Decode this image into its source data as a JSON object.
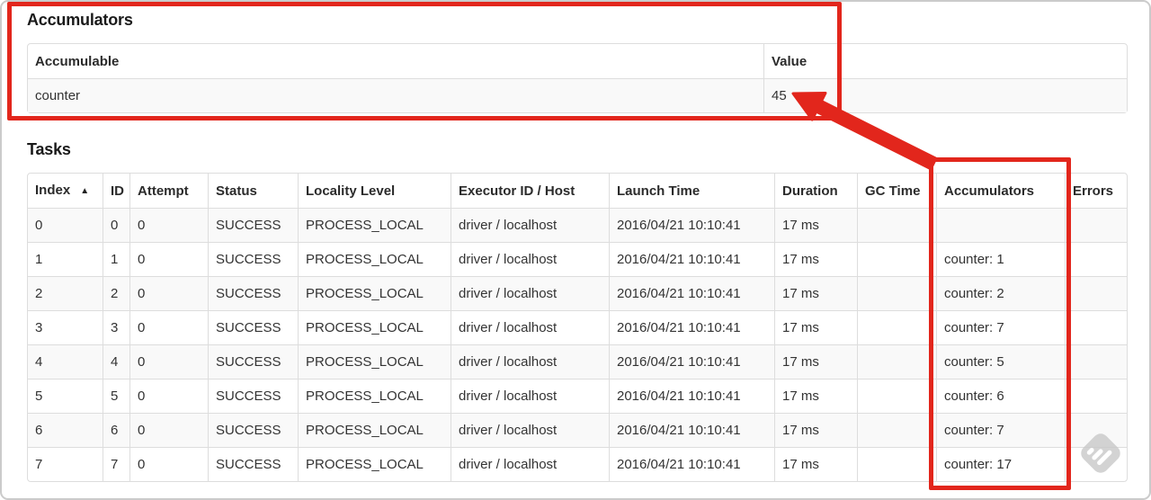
{
  "theme": {
    "annotation_color": "#e2261c",
    "table_border_color": "#dddddd",
    "stripe_color": "#f9f9f9",
    "text_color": "#333333",
    "watermark_color": "#c9c9c9"
  },
  "accumulators_section": {
    "title": "Accumulators",
    "table": {
      "headers": [
        "Accumulable",
        "Value"
      ],
      "rows": [
        [
          "counter",
          "45"
        ]
      ]
    }
  },
  "tasks_section": {
    "title": "Tasks",
    "table": {
      "headers": [
        "Index",
        "ID",
        "Attempt",
        "Status",
        "Locality Level",
        "Executor ID / Host",
        "Launch Time",
        "Duration",
        "GC Time",
        "Accumulators",
        "Errors"
      ],
      "sort_icon": "▲",
      "rows": [
        [
          "0",
          "0",
          "0",
          "SUCCESS",
          "PROCESS_LOCAL",
          "driver / localhost",
          "2016/04/21 10:10:41",
          "17 ms",
          "",
          "",
          ""
        ],
        [
          "1",
          "1",
          "0",
          "SUCCESS",
          "PROCESS_LOCAL",
          "driver / localhost",
          "2016/04/21 10:10:41",
          "17 ms",
          "",
          "counter: 1",
          ""
        ],
        [
          "2",
          "2",
          "0",
          "SUCCESS",
          "PROCESS_LOCAL",
          "driver / localhost",
          "2016/04/21 10:10:41",
          "17 ms",
          "",
          "counter: 2",
          ""
        ],
        [
          "3",
          "3",
          "0",
          "SUCCESS",
          "PROCESS_LOCAL",
          "driver / localhost",
          "2016/04/21 10:10:41",
          "17 ms",
          "",
          "counter: 7",
          ""
        ],
        [
          "4",
          "4",
          "0",
          "SUCCESS",
          "PROCESS_LOCAL",
          "driver / localhost",
          "2016/04/21 10:10:41",
          "17 ms",
          "",
          "counter: 5",
          ""
        ],
        [
          "5",
          "5",
          "0",
          "SUCCESS",
          "PROCESS_LOCAL",
          "driver / localhost",
          "2016/04/21 10:10:41",
          "17 ms",
          "",
          "counter: 6",
          ""
        ],
        [
          "6",
          "6",
          "0",
          "SUCCESS",
          "PROCESS_LOCAL",
          "driver / localhost",
          "2016/04/21 10:10:41",
          "17 ms",
          "",
          "counter: 7",
          ""
        ],
        [
          "7",
          "7",
          "0",
          "SUCCESS",
          "PROCESS_LOCAL",
          "driver / localhost",
          "2016/04/21 10:10:41",
          "17 ms",
          "",
          "counter: 17",
          ""
        ]
      ]
    }
  }
}
